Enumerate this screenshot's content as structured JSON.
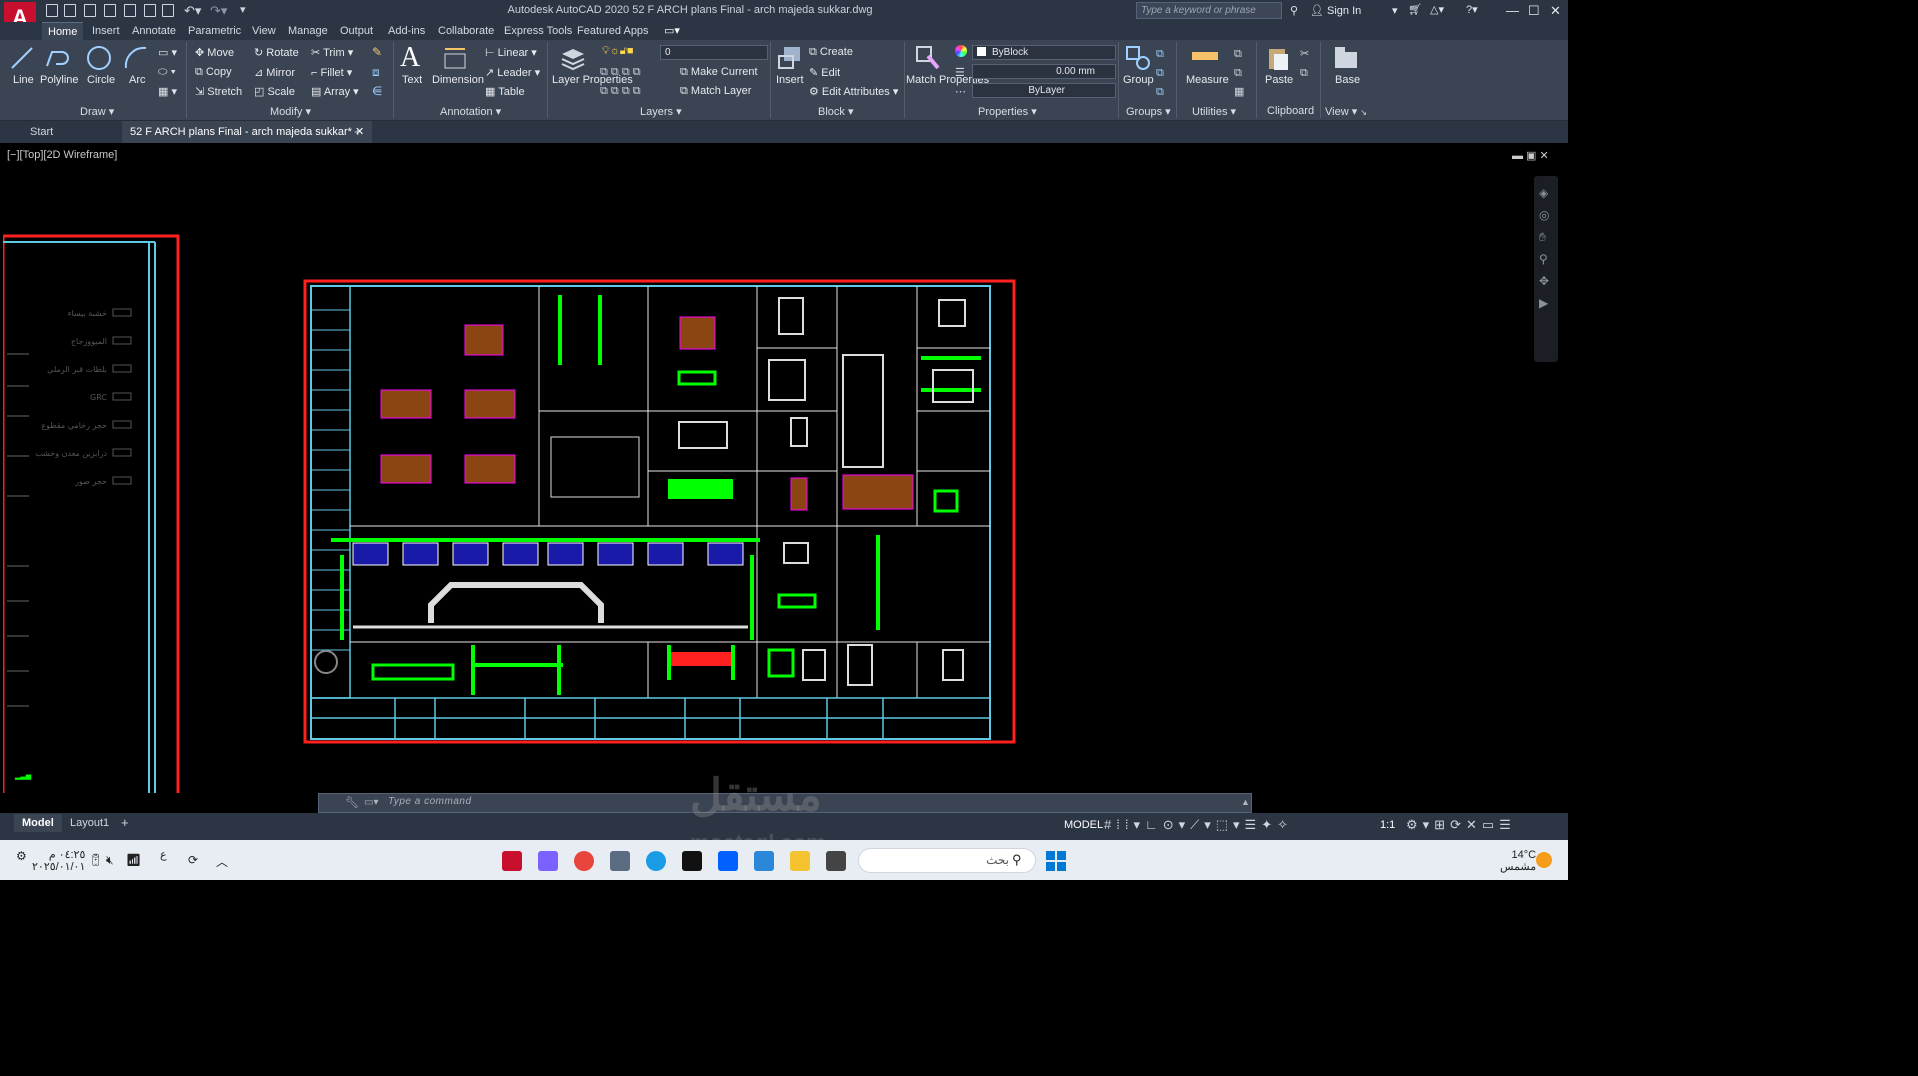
{
  "window": {
    "title": "Autodesk AutoCAD 2020    52 F ARCH plans Final - arch majeda sukkar.dwg",
    "search_placeholder": "Type a keyword or phrase",
    "sign_in": "Sign In",
    "app_letter": "A"
  },
  "ribbon_tabs": [
    "Home",
    "Insert",
    "Annotate",
    "Parametric",
    "View",
    "Manage",
    "Output",
    "Add-ins",
    "Collaborate",
    "Express Tools",
    "Featured Apps"
  ],
  "ribbon": {
    "draw": {
      "title": "Draw",
      "line": "Line",
      "polyline": "Polyline",
      "circle": "Circle",
      "arc": "Arc"
    },
    "modify": {
      "title": "Modify",
      "move": "Move",
      "rotate": "Rotate",
      "trim": "Trim",
      "copy": "Copy",
      "mirror": "Mirror",
      "fillet": "Fillet",
      "stretch": "Stretch",
      "scale": "Scale",
      "array": "Array"
    },
    "annotation": {
      "title": "Annotation",
      "text": "Text",
      "dimension": "Dimension",
      "linear": "Linear",
      "leader": "Leader",
      "table": "Table"
    },
    "layers": {
      "title": "Layers",
      "layer_properties": "Layer Properties",
      "current_layer": "0",
      "make_current": "Make Current",
      "match_layer": "Match Layer"
    },
    "block": {
      "title": "Block",
      "insert": "Insert",
      "create": "Create",
      "edit": "Edit",
      "edit_attributes": "Edit Attributes"
    },
    "properties": {
      "title": "Properties",
      "match_properties": "Match Properties",
      "color": "ByBlock",
      "lineweight": "0.00 mm",
      "linetype": "ByLayer"
    },
    "groups": {
      "title": "Groups",
      "group": "Group"
    },
    "utilities": {
      "title": "Utilities",
      "measure": "Measure"
    },
    "clipboard": {
      "title": "Clipboard",
      "paste": "Paste"
    },
    "view": {
      "title": "View",
      "base": "Base"
    }
  },
  "doc_tabs": {
    "start": "Start",
    "file": "52 F ARCH plans Final - arch majeda sukkar*"
  },
  "viewport_label": "[−][Top][2D Wireframe]",
  "command_line": {
    "placeholder": "Type a command"
  },
  "layout_tabs": [
    "Model",
    "Layout1"
  ],
  "status": {
    "model": "MODEL",
    "scale": "1:1"
  },
  "left_legend": [
    "خشبة بيساء",
    "الميووزجاج",
    "بلطات قبر الرملي",
    "GRC",
    "حجر رخامي مقطوع",
    "درابزين معدن وخشب",
    "حجر صور"
  ],
  "taskbar": {
    "search": "بحث",
    "time": "٠٤:٢٥ م",
    "date": "٢٠٢٥/٠١/٠١",
    "temp": "14°C",
    "weather": "مشمس",
    "lang": "ع"
  },
  "watermark": {
    "arabic": "مستقل",
    "latin": "mostaql.com"
  },
  "colors": {
    "accent_green": "#00ff00",
    "frame_red": "#ff0000",
    "line_cyan": "#5fc9e6",
    "magenta": "#ff00ff"
  }
}
